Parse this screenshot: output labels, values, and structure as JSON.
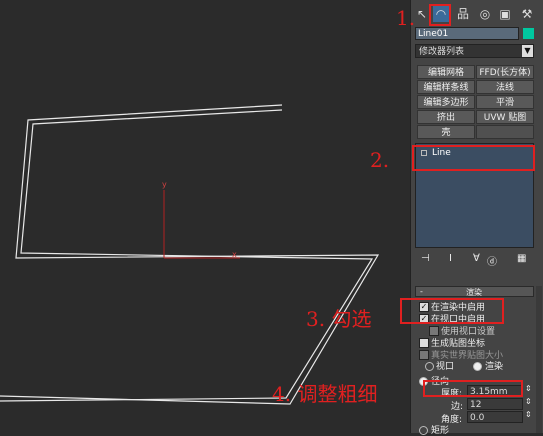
{
  "toolbar": {
    "tabs": [
      {
        "name": "create-tab",
        "glyph": "↖"
      },
      {
        "name": "modify-tab",
        "glyph": "◠"
      },
      {
        "name": "hierarchy-tab",
        "glyph": "品"
      },
      {
        "name": "motion-tab",
        "glyph": "◎"
      },
      {
        "name": "display-tab",
        "glyph": "▣"
      },
      {
        "name": "utilities-tab",
        "glyph": "⚒"
      }
    ]
  },
  "object": {
    "name": "Line01",
    "color": "#00c8a0"
  },
  "modifier_list": {
    "label": "修改器列表"
  },
  "modifier_buttons": [
    [
      "编辑网格",
      "FFD(长方体)"
    ],
    [
      "编辑样条线",
      "法线"
    ],
    [
      "编辑多边形",
      "平滑"
    ],
    [
      "挤出",
      "UVW 贴图"
    ],
    [
      "壳",
      ""
    ]
  ],
  "stack": {
    "item": "Line"
  },
  "rendering": {
    "header": "渲染",
    "enable_in_renderer": "在渲染中启用",
    "enable_in_viewport": "在视口中启用",
    "use_viewport_settings": "使用视口设置",
    "gen_mapping_coords": "生成贴图坐标",
    "real_world_map_size": "真实世界贴图大小",
    "viewport_option": "视口",
    "renderer_option": "渲染",
    "radial_label": "径向",
    "thickness_label": "厚度:",
    "thickness_value": "3.15mm",
    "sides_label": "边:",
    "sides_value": "12",
    "angle_label": "角度:",
    "angle_value": "0.0",
    "rect_label": "矩形"
  },
  "annotations": {
    "step1": "1.",
    "step2": "2.",
    "step3": "3. 勾选",
    "step4": "4. 调整粗细"
  },
  "axis": {
    "y": "y",
    "x": "x"
  },
  "colors": {
    "accent": "#e02020",
    "panel": "#444444",
    "viewport": "#2b2b2b"
  }
}
